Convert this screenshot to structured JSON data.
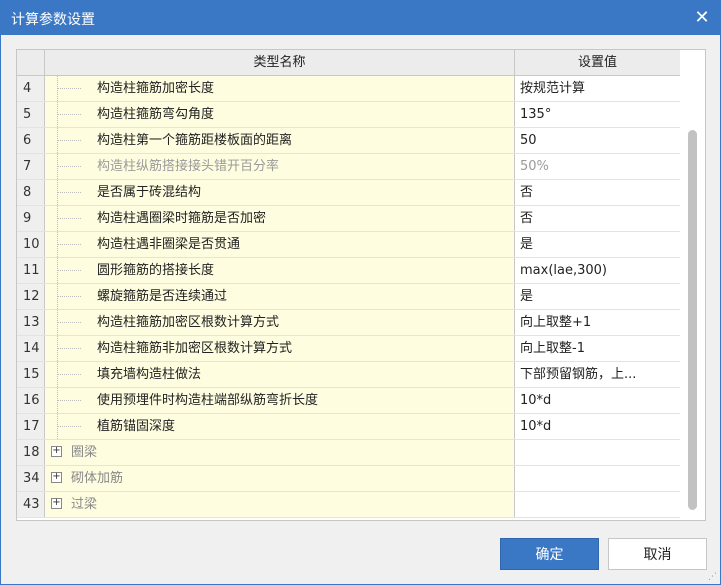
{
  "window": {
    "title": "计算参数设置",
    "close_glyph": "✕"
  },
  "table": {
    "columns": [
      "类型名称",
      "设置值"
    ],
    "rows": [
      {
        "num": "4",
        "name": "构造柱箍筋加密长度",
        "value": "按规范计算",
        "disabled": false
      },
      {
        "num": "5",
        "name": "构造柱箍筋弯勾角度",
        "value": "135°",
        "disabled": false
      },
      {
        "num": "6",
        "name": "构造柱第一个箍筋距楼板面的距离",
        "value": "50",
        "disabled": false
      },
      {
        "num": "7",
        "name": "构造柱纵筋搭接接头错开百分率",
        "value": "50%",
        "disabled": true
      },
      {
        "num": "8",
        "name": "是否属于砖混结构",
        "value": "否",
        "disabled": false
      },
      {
        "num": "9",
        "name": "构造柱遇圈梁时箍筋是否加密",
        "value": "否",
        "disabled": false
      },
      {
        "num": "10",
        "name": "构造柱遇非圈梁是否贯通",
        "value": "是",
        "disabled": false
      },
      {
        "num": "11",
        "name": "圆形箍筋的搭接长度",
        "value": "max(lae,300)",
        "disabled": false
      },
      {
        "num": "12",
        "name": "螺旋箍筋是否连续通过",
        "value": "是",
        "disabled": false
      },
      {
        "num": "13",
        "name": "构造柱箍筋加密区根数计算方式",
        "value": "向上取整+1",
        "disabled": false
      },
      {
        "num": "14",
        "name": "构造柱箍筋非加密区根数计算方式",
        "value": "向上取整-1",
        "disabled": false
      },
      {
        "num": "15",
        "name": "填充墙构造柱做法",
        "value": "下部预留钢筋，上...",
        "disabled": false
      },
      {
        "num": "16",
        "name": "使用预埋件时构造柱端部纵筋弯折长度",
        "value": "10*d",
        "disabled": false
      },
      {
        "num": "17",
        "name": "植筋锚固深度",
        "value": "10*d",
        "disabled": false
      }
    ],
    "groups": [
      {
        "num": "18",
        "name": "圈梁",
        "expander": "+"
      },
      {
        "num": "34",
        "name": "砌体加筋",
        "expander": "+"
      },
      {
        "num": "43",
        "name": "过梁",
        "expander": "+"
      }
    ]
  },
  "buttons": {
    "ok": "确定",
    "cancel": "取消"
  },
  "colors": {
    "accent": "#3a78c6",
    "name_cell_bg": "#fffde0",
    "disabled_text": "#9a9a9a"
  }
}
